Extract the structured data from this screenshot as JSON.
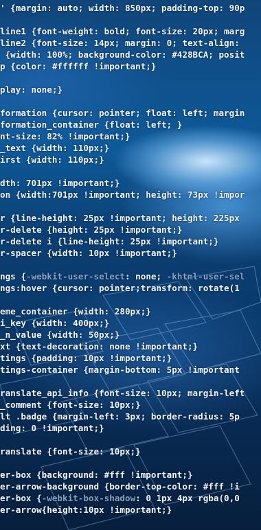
{
  "code_lines": [
    {
      "segments": [
        {
          "t": "' {margin: auto; width: 850px; padding-top: 90p"
        }
      ]
    },
    {
      "segments": []
    },
    {
      "segments": [
        {
          "t": "line1 {font-weight: bold; font-size: 20px; marg"
        }
      ]
    },
    {
      "segments": [
        {
          "t": "line2 {font-size: 14px; margin: 0; text-align: "
        }
      ]
    },
    {
      "segments": [
        {
          "t": " {width: 100%; background-color: #428BCA; posit"
        }
      ]
    },
    {
      "segments": [
        {
          "t": "p {color: #ffffff !important;}"
        }
      ]
    },
    {
      "segments": []
    },
    {
      "segments": [
        {
          "t": "play: none;}"
        }
      ]
    },
    {
      "segments": []
    },
    {
      "segments": [
        {
          "t": "formation {cursor: pointer; float: left; margin"
        }
      ]
    },
    {
      "segments": [
        {
          "t": "formation_container {float: left; }"
        }
      ]
    },
    {
      "segments": [
        {
          "t": "nt-size: 82% !important;}"
        }
      ]
    },
    {
      "segments": [
        {
          "t": "_text {width: 110px;}"
        }
      ]
    },
    {
      "segments": [
        {
          "t": "irst {width: 110px;}"
        }
      ]
    },
    {
      "segments": []
    },
    {
      "segments": [
        {
          "t": "dth: 701px !important;}"
        }
      ]
    },
    {
      "segments": [
        {
          "t": "on {width:701px !important; height: 73px !impor"
        }
      ]
    },
    {
      "segments": []
    },
    {
      "segments": [
        {
          "t": "r {line-height: 25px !important; height: 225px"
        }
      ]
    },
    {
      "segments": [
        {
          "t": "r-delete {height: 25px !important;}"
        }
      ]
    },
    {
      "segments": [
        {
          "t": "r-delete i {line-height: 25px !important;}"
        }
      ]
    },
    {
      "segments": [
        {
          "t": "r-spacer {width: 10px !important;}"
        }
      ]
    },
    {
      "segments": []
    },
    {
      "segments": [
        {
          "t": "ngs {"
        },
        {
          "t": "-webkit-user-select",
          "dim": true
        },
        {
          "t": ": none; "
        },
        {
          "t": "-khtml-user-sel",
          "dim": true
        }
      ]
    },
    {
      "segments": [
        {
          "t": "ngs:hover {cursor: pointer;transform: rotate(1"
        }
      ]
    },
    {
      "segments": []
    },
    {
      "segments": [
        {
          "t": "eme_container {width: 280px;}"
        }
      ]
    },
    {
      "segments": [
        {
          "t": "i_key {width: 400px;}"
        }
      ]
    },
    {
      "segments": [
        {
          "t": "_n_value {width: 50px;}"
        }
      ]
    },
    {
      "segments": [
        {
          "t": "xt {text-decoration: none !important;}"
        }
      ]
    },
    {
      "segments": [
        {
          "t": "tings {padding: 10px !important;}"
        }
      ]
    },
    {
      "segments": [
        {
          "t": "tings-container {margin-bottom: 5px !important"
        }
      ]
    },
    {
      "segments": []
    },
    {
      "segments": [
        {
          "t": "ranslate_api_info {font-size: 10px; margin-left"
        }
      ]
    },
    {
      "segments": [
        {
          "t": "_comment {font-size: 10px;}"
        }
      ]
    },
    {
      "segments": [
        {
          "t": "lt .badge {margin-left: 3px; border-radius: 5p"
        }
      ]
    },
    {
      "segments": [
        {
          "t": "ding: 0 !important;}"
        }
      ]
    },
    {
      "segments": []
    },
    {
      "segments": [
        {
          "t": "ranslate {font-size: 10px;}"
        }
      ]
    },
    {
      "segments": []
    },
    {
      "segments": [
        {
          "t": "er-box {background: #fff !important;}"
        }
      ]
    },
    {
      "segments": [
        {
          "t": "er-arrow-background {border-top-color: #fff !i"
        }
      ]
    },
    {
      "segments": [
        {
          "t": "er-box {"
        },
        {
          "t": "-webkit-box-shadow",
          "dim": true
        },
        {
          "t": ": 0 1px 4px rgba(0,0"
        }
      ]
    },
    {
      "segments": [
        {
          "t": "er-arrow{height:10px !important;}"
        }
      ]
    }
  ]
}
